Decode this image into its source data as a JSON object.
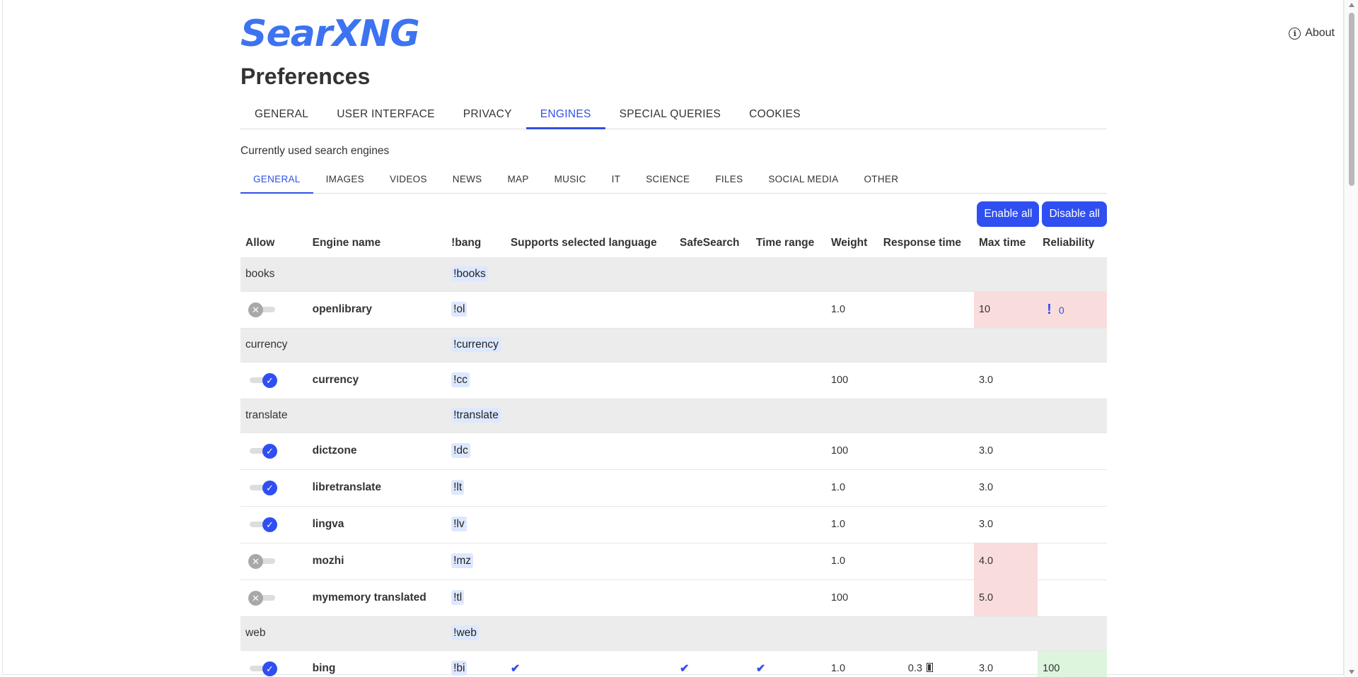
{
  "brand": {
    "logo_text": "SearXNG",
    "accent_color": "#2f4ff2"
  },
  "header": {
    "about_label": "About",
    "about_icon": "info-icon"
  },
  "page": {
    "title": "Preferences",
    "subtitle": "Currently used search engines"
  },
  "tabs": [
    "GENERAL",
    "USER INTERFACE",
    "PRIVACY",
    "ENGINES",
    "SPECIAL QUERIES",
    "COOKIES"
  ],
  "active_tab": "ENGINES",
  "subtabs": [
    "GENERAL",
    "IMAGES",
    "VIDEOS",
    "NEWS",
    "MAP",
    "MUSIC",
    "IT",
    "SCIENCE",
    "FILES",
    "SOCIAL MEDIA",
    "OTHER"
  ],
  "active_subtab": "GENERAL",
  "buttons": {
    "enable_all": "Enable all",
    "disable_all": "Disable all"
  },
  "table": {
    "headers": [
      "Allow",
      "Engine name",
      "!bang",
      "Supports selected language",
      "SafeSearch",
      "Time range",
      "Weight",
      "Response time",
      "Max time",
      "Reliability"
    ],
    "rows": [
      {
        "type": "group",
        "name": "books",
        "bang": "!books"
      },
      {
        "type": "engine",
        "enabled": false,
        "name": "openlibrary",
        "bang": "!ol",
        "lang": false,
        "safe": false,
        "time": false,
        "weight": "1.0",
        "response": "",
        "max_time": "10",
        "max_time_warn": true,
        "reliability": "0",
        "reliability_warn": true
      },
      {
        "type": "group",
        "name": "currency",
        "bang": "!currency"
      },
      {
        "type": "engine",
        "enabled": true,
        "name": "currency",
        "bang": "!cc",
        "lang": false,
        "safe": false,
        "time": false,
        "weight": "100",
        "response": "",
        "max_time": "3.0",
        "max_time_warn": false,
        "reliability": "",
        "reliability_warn": false
      },
      {
        "type": "group",
        "name": "translate",
        "bang": "!translate"
      },
      {
        "type": "engine",
        "enabled": true,
        "name": "dictzone",
        "bang": "!dc",
        "lang": false,
        "safe": false,
        "time": false,
        "weight": "100",
        "response": "",
        "max_time": "3.0",
        "max_time_warn": false,
        "reliability": "",
        "reliability_warn": false
      },
      {
        "type": "engine",
        "enabled": true,
        "name": "libretranslate",
        "bang": "!lt",
        "lang": false,
        "safe": false,
        "time": false,
        "weight": "1.0",
        "response": "",
        "max_time": "3.0",
        "max_time_warn": false,
        "reliability": "",
        "reliability_warn": false
      },
      {
        "type": "engine",
        "enabled": true,
        "name": "lingva",
        "bang": "!lv",
        "lang": false,
        "safe": false,
        "time": false,
        "weight": "1.0",
        "response": "",
        "max_time": "3.0",
        "max_time_warn": false,
        "reliability": "",
        "reliability_warn": false
      },
      {
        "type": "engine",
        "enabled": false,
        "name": "mozhi",
        "bang": "!mz",
        "lang": false,
        "safe": false,
        "time": false,
        "weight": "1.0",
        "response": "",
        "max_time": "4.0",
        "max_time_warn": true,
        "reliability": "",
        "reliability_warn": false
      },
      {
        "type": "engine",
        "enabled": false,
        "name": "mymemory translated",
        "bang": "!tl",
        "lang": false,
        "safe": false,
        "time": false,
        "weight": "100",
        "response": "",
        "max_time": "5.0",
        "max_time_warn": true,
        "reliability": "",
        "reliability_warn": false
      },
      {
        "type": "group",
        "name": "web",
        "bang": "!web"
      },
      {
        "type": "engine",
        "enabled": true,
        "name": "bing",
        "bang": "!bi",
        "lang": true,
        "safe": true,
        "time": true,
        "weight": "1.0",
        "response": "0.3",
        "max_time": "3.0",
        "max_time_warn": false,
        "reliability": "100",
        "reliability_good": true
      }
    ]
  }
}
